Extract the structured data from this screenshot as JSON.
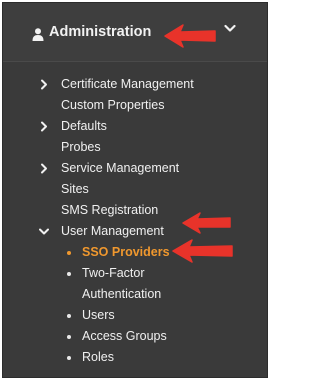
{
  "header": {
    "title": "Administration",
    "icon": "user-icon",
    "expand_icon": "chevron-down-icon"
  },
  "menu": {
    "items": [
      {
        "label": "Certificate Management",
        "has_children": true
      },
      {
        "label": "Custom Properties",
        "has_children": false
      },
      {
        "label": "Defaults",
        "has_children": true
      },
      {
        "label": "Probes",
        "has_children": false
      },
      {
        "label": "Service Management",
        "has_children": true
      },
      {
        "label": "Sites",
        "has_children": false
      },
      {
        "label": "SMS Registration",
        "has_children": false
      },
      {
        "label": "User Management",
        "has_children": true,
        "expanded": true
      }
    ],
    "user_management_children": [
      {
        "label": "SSO Providers",
        "active": true
      },
      {
        "label": "Two-Factor Authentication",
        "active": false
      },
      {
        "label": "Users",
        "active": false
      },
      {
        "label": "Access Groups",
        "active": false
      },
      {
        "label": "Roles",
        "active": false
      }
    ]
  },
  "colors": {
    "panel_bg": "#3a3a3a",
    "text": "#f0f0f0",
    "active": "#f0982e",
    "annotation_arrow": "#e8332a"
  }
}
